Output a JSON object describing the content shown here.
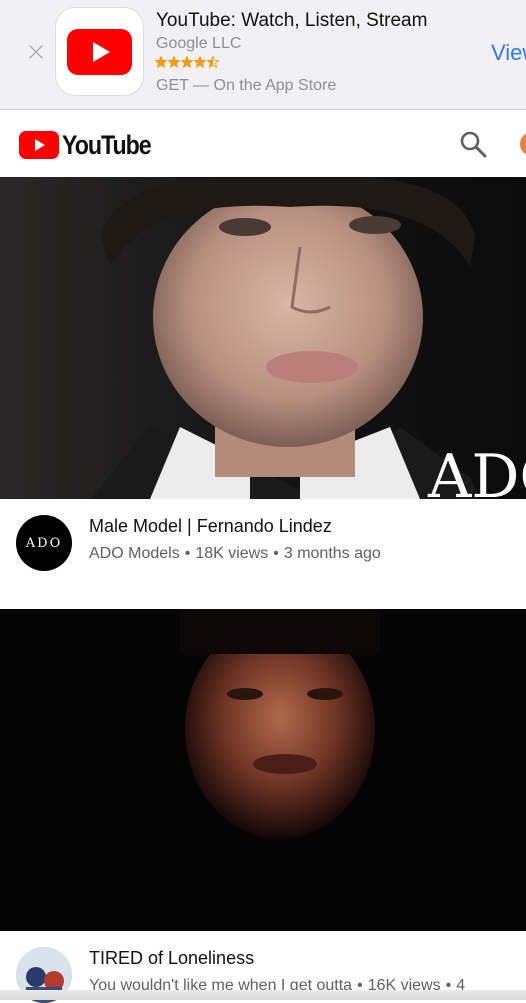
{
  "app_banner": {
    "close_icon": "close-icon",
    "app_name": "YouTube: Watch, Listen, Stream",
    "developer": "Google LLC",
    "rating_stars": 4.5,
    "rating_max": 5,
    "get_text": "GET — On the App Store",
    "view_label": "View",
    "star_color": "#f39c12",
    "view_color": "#3478f6"
  },
  "header": {
    "logo_text": "YouTube",
    "logo_red": "#ff0000",
    "search_icon": "search-icon",
    "account_icon": "avatar"
  },
  "videos": [
    {
      "thumbnail_overlay_text": "ADO",
      "channel_avatar_text": "ADO",
      "title": "Male Model | Fernando Lindez",
      "channel": "ADO Models",
      "views": "18K views",
      "age": "3 months ago"
    },
    {
      "title": "TIRED of Loneliness",
      "channel": "You wouldn't like me when I get outta",
      "views": "16K views",
      "age": "4"
    }
  ]
}
